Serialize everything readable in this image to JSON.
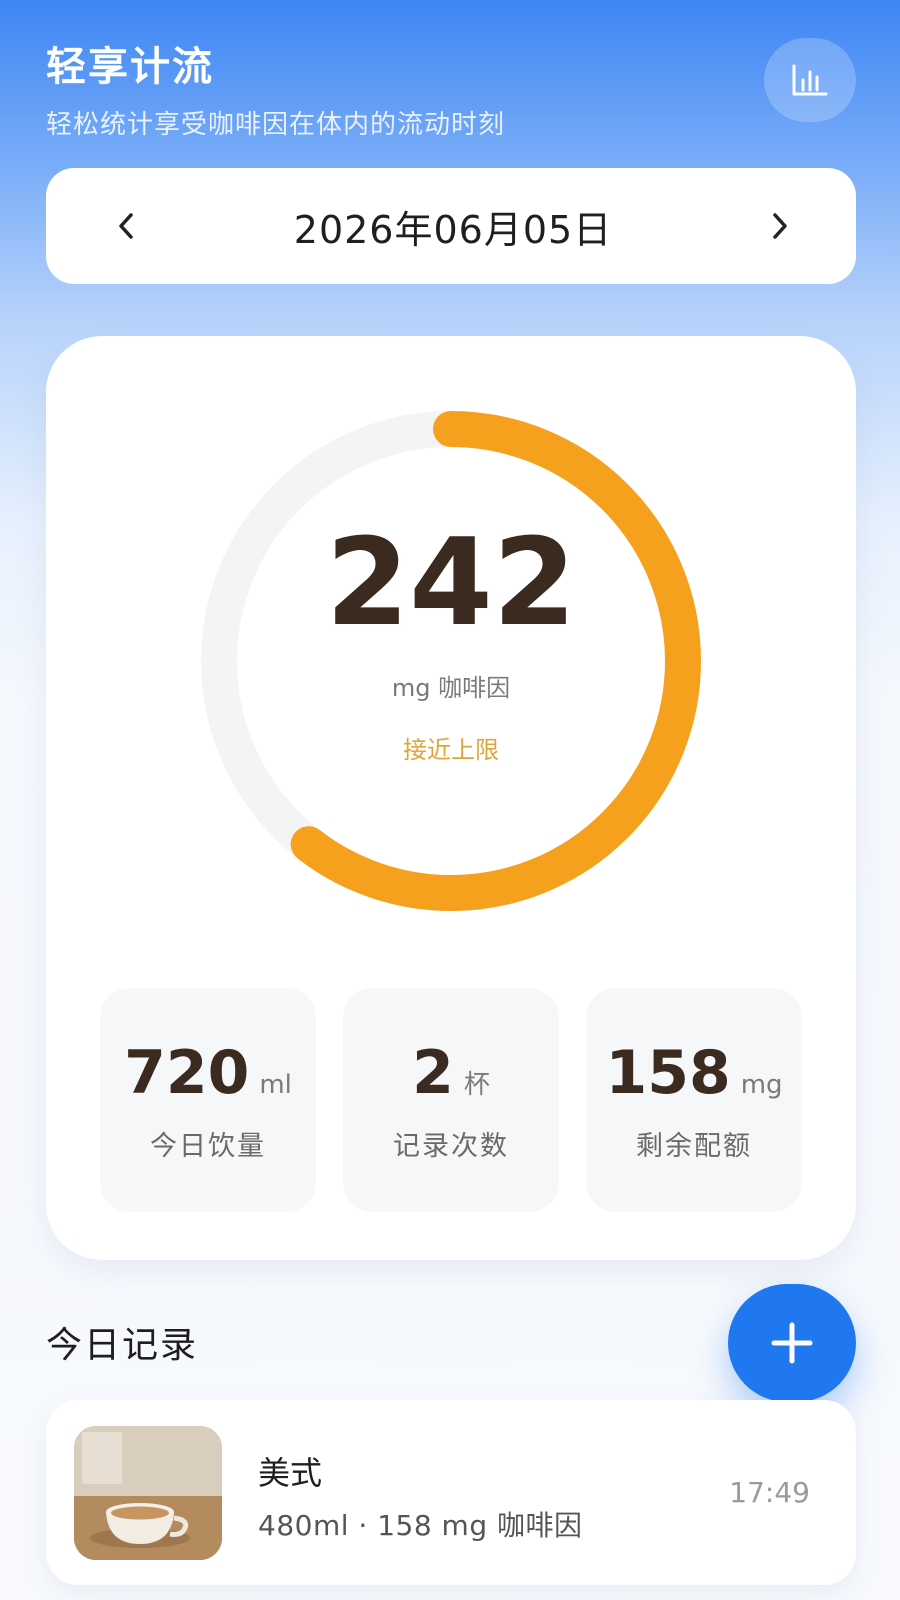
{
  "header": {
    "title": "轻享计流",
    "subtitle": "轻松统计享受咖啡因在体内的流动时刻",
    "stats_icon": "bar-chart-icon"
  },
  "date_nav": {
    "date": "2026年06月05日",
    "prev_icon": "chevron-left-icon",
    "next_icon": "chevron-right-icon"
  },
  "summary": {
    "caffeine_value": "242",
    "caffeine_unit": "mg 咖啡因",
    "status": "接近上限",
    "progress_fraction": 0.605,
    "colors": {
      "ring_track": "#f4f4f4",
      "ring_fill": "#f6a11e",
      "status": "#e0a43a"
    },
    "stats": [
      {
        "value": "720",
        "unit": "ml",
        "label": "今日饮量"
      },
      {
        "value": "2",
        "unit": "杯",
        "label": "记录次数"
      },
      {
        "value": "158",
        "unit": "mg",
        "label": "剩余配额"
      }
    ]
  },
  "records": {
    "section_title": "今日记录",
    "add_icon": "plus-icon",
    "items": [
      {
        "name": "美式",
        "detail": "480ml · 158 mg 咖啡因",
        "time": "17:49",
        "thumb_icon": "coffee-cup-photo"
      }
    ]
  },
  "colors": {
    "accent": "#1f78f0",
    "text_dark": "#3b2a1f"
  }
}
